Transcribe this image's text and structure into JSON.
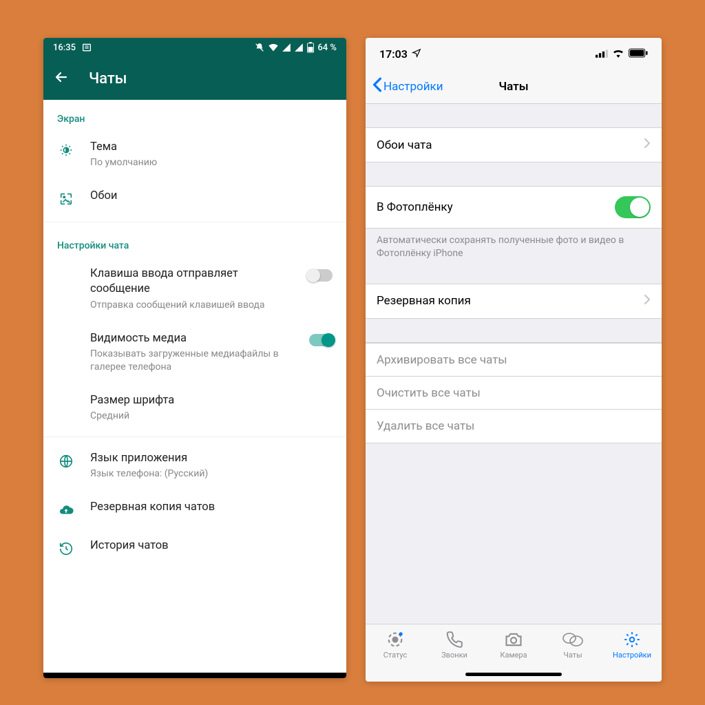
{
  "android": {
    "statusbar": {
      "time": "16:35",
      "battery": "64 %"
    },
    "appbar": {
      "title": "Чаты"
    },
    "section_screen": "Экран",
    "theme": {
      "title": "Тема",
      "sub": "По умолчанию"
    },
    "wallpaper": {
      "title": "Обои"
    },
    "section_chat": "Настройки чата",
    "enter_send": {
      "title": "Клавиша ввода отправляет сообщение",
      "sub": "Отправка сообщений клавишей ввода",
      "on": false
    },
    "media_vis": {
      "title": "Видимость медиа",
      "sub": "Показывать загруженные медиафайлы в галерее телефона",
      "on": true
    },
    "font_size": {
      "title": "Размер шрифта",
      "sub": "Средний"
    },
    "lang": {
      "title": "Язык приложения",
      "sub": "Язык телефона: (Русский)"
    },
    "backup": {
      "title": "Резервная копия чатов"
    },
    "history": {
      "title": "История чатов"
    }
  },
  "ios": {
    "statusbar": {
      "time": "17:03"
    },
    "navbar": {
      "back": "Настройки",
      "title": "Чаты"
    },
    "wallpaper": "Обои чата",
    "camera_roll": {
      "title": "В Фотоплёнку",
      "footer": "Автоматически сохранять полученные фото и видео в Фотоплёнку iPhone",
      "on": true
    },
    "backup": "Резервная копия",
    "archive": "Архивировать все чаты",
    "clear": "Очистить все чаты",
    "delete": "Удалить все чаты",
    "tabs": {
      "status": "Статус",
      "calls": "Звонки",
      "camera": "Камера",
      "chats": "Чаты",
      "settings": "Настройки"
    }
  }
}
